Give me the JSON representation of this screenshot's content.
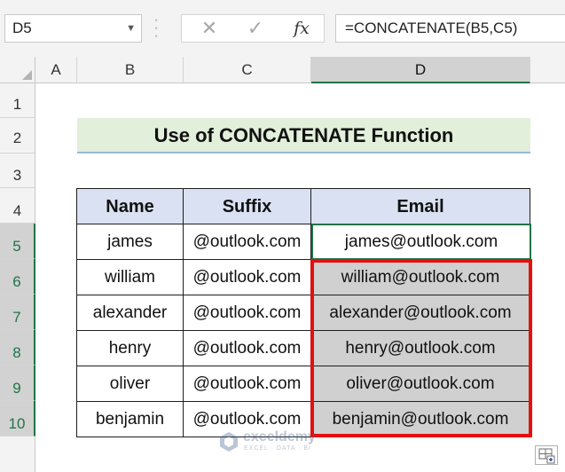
{
  "name_box": {
    "value": "D5"
  },
  "formula_bar": {
    "cancel_glyph": "✕",
    "enter_glyph": "✓",
    "fx_label": "fx",
    "formula": "=CONCATENATE(B5,C5)"
  },
  "columns": [
    "A",
    "B",
    "C",
    "D"
  ],
  "rows": [
    "1",
    "2",
    "3",
    "4",
    "5",
    "6",
    "7",
    "8",
    "9",
    "10"
  ],
  "title": "Use of CONCATENATE Function",
  "table": {
    "headers": [
      "Name",
      "Suffix",
      "Email"
    ],
    "rows": [
      [
        "james",
        "@outlook.com",
        "james@outlook.com"
      ],
      [
        "william",
        "@outlook.com",
        "william@outlook.com"
      ],
      [
        "alexander",
        "@outlook.com",
        "alexander@outlook.com"
      ],
      [
        "henry",
        "@outlook.com",
        "henry@outlook.com"
      ],
      [
        "oliver",
        "@outlook.com",
        "oliver@outlook.com"
      ],
      [
        "benjamin",
        "@outlook.com",
        "benjamin@outlook.com"
      ]
    ]
  },
  "watermark": {
    "name": "exceldemy",
    "tagline": "EXCEL · DATA · BI"
  },
  "colors": {
    "excel_green": "#217346",
    "title_fill": "#e2efda",
    "header_fill": "#d9e1f2",
    "highlight_red": "#e3100f",
    "selection_gray": "#d0d0d0"
  },
  "icons": {
    "name_box_dropdown": "chevron-down-icon",
    "quick_analysis": "quick-analysis-icon"
  }
}
